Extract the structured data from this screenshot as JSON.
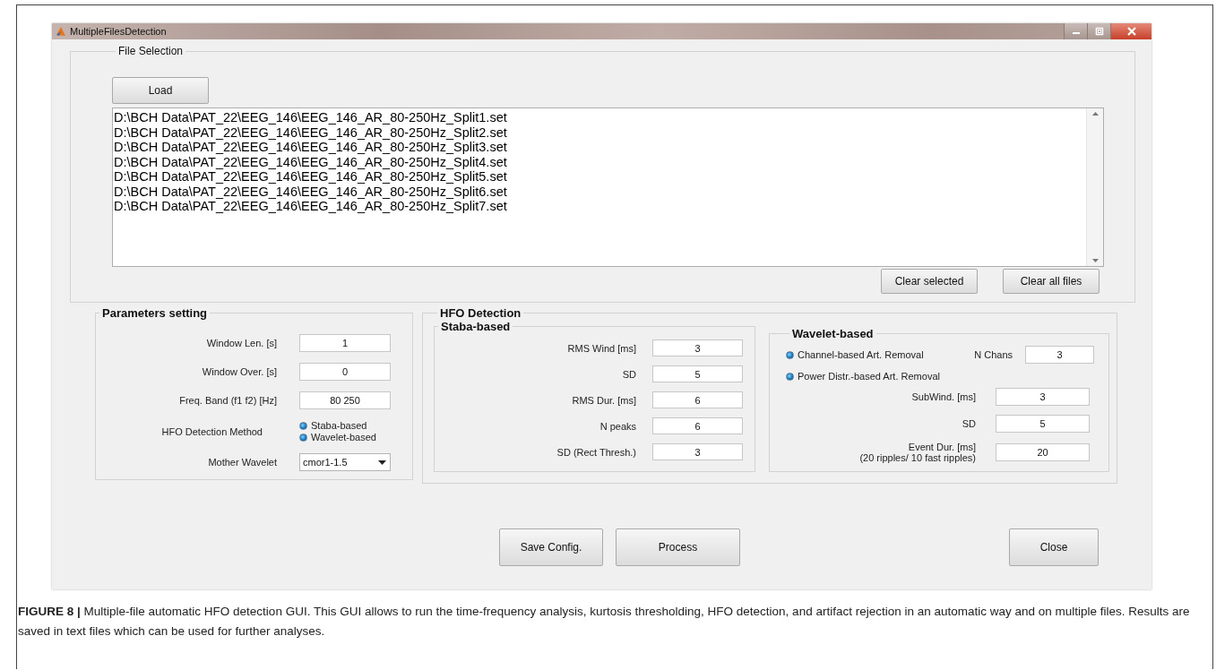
{
  "window": {
    "title": "MultipleFilesDetection"
  },
  "file_selection": {
    "title": "File Selection",
    "load_button": "Load",
    "files": [
      "D:\\BCH Data\\PAT_22\\EEG_146\\EEG_146_AR_80-250Hz_Split1.set",
      "D:\\BCH Data\\PAT_22\\EEG_146\\EEG_146_AR_80-250Hz_Split2.set",
      "D:\\BCH Data\\PAT_22\\EEG_146\\EEG_146_AR_80-250Hz_Split3.set",
      "D:\\BCH Data\\PAT_22\\EEG_146\\EEG_146_AR_80-250Hz_Split4.set",
      "D:\\BCH Data\\PAT_22\\EEG_146\\EEG_146_AR_80-250Hz_Split5.set",
      "D:\\BCH Data\\PAT_22\\EEG_146\\EEG_146_AR_80-250Hz_Split6.set",
      "D:\\BCH Data\\PAT_22\\EEG_146\\EEG_146_AR_80-250Hz_Split7.set"
    ],
    "buttons": [
      "Clear selected",
      "Clear all files"
    ]
  },
  "parameters": {
    "title": "Parameters setting",
    "fields": [
      {
        "label": "Window Len. [s]",
        "value": "1"
      },
      {
        "label": "Window Over. [s]",
        "value": "0"
      },
      {
        "label": "Freq. Band (f1 f2) [Hz]",
        "value": "80 250"
      }
    ],
    "method": {
      "label": "HFO Detection Method",
      "options": [
        {
          "label": "Staba-based",
          "selected": true
        },
        {
          "label": "Wavelet-based",
          "selected": true
        }
      ]
    },
    "mother_wavelet": {
      "label": "Mother Wavelet",
      "value": "cmor1-1.5"
    }
  },
  "hfo_detection": {
    "title": "HFO Detection",
    "staba": {
      "title": "Staba-based",
      "fields": [
        {
          "label": "RMS Wind [ms]",
          "value": "3"
        },
        {
          "label": "SD",
          "value": "5"
        },
        {
          "label": "RMS Dur. [ms]",
          "value": "6"
        },
        {
          "label": "N peaks",
          "value": "6"
        },
        {
          "label": "SD (Rect Thresh.)",
          "value": "3"
        }
      ]
    },
    "wavelet": {
      "title": "Wavelet-based",
      "options": [
        {
          "label": "Channel-based Art. Removal",
          "selected": true
        },
        {
          "label": "Power Distr.-based Art. Removal",
          "selected": true
        }
      ],
      "n_chans": {
        "label": "N Chans",
        "value": "3"
      },
      "fields": [
        {
          "label": "SubWind. [ms]",
          "value": "3"
        },
        {
          "label": "SD",
          "value": "5"
        },
        {
          "label": "Event Dur. [ms]\n(20 ripples/ 10 fast ripples)",
          "value": "20"
        }
      ]
    }
  },
  "buttons": [
    "Save Config.",
    "Process",
    "Close"
  ],
  "caption": "**FIGURE 8 |** Multiple-file automatic HFO detection GUI. This GUI allows to run the time-frequency analysis, kurtosis thresholding, HFO detection, and artifact rejection in an automatic way and on multiple files. Results are saved in text files which can be used for further analyses."
}
